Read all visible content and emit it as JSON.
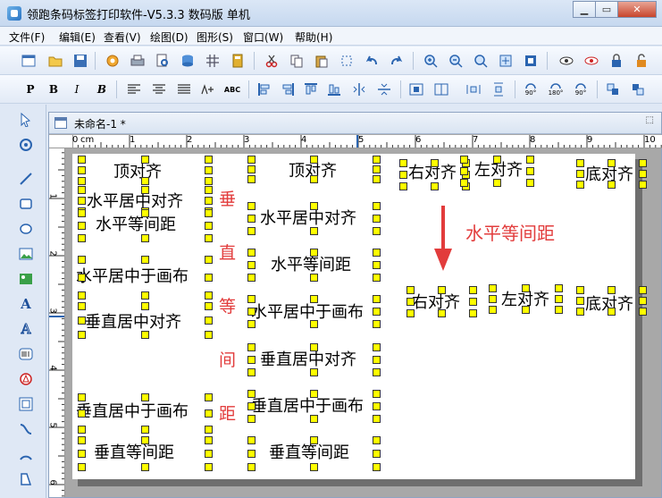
{
  "window": {
    "title": "领跑条码标签打印软件-V5.3.3 数码版 单机"
  },
  "menu": [
    "文件(F)",
    "编辑(E)",
    "查看(V)",
    "绘图(D)",
    "图形(S)",
    "窗口(W)",
    "帮助(H)"
  ],
  "format_toolbar": {
    "bold": "B",
    "italic": "I",
    "abc": "ABC",
    "rot90": "90°",
    "rot180": "180°",
    "rot270": "90°"
  },
  "left_tools": {
    "text_tool": "A",
    "art_text_tool": "A"
  },
  "document": {
    "tab_title": "未命名-1 *",
    "unit": "cm"
  },
  "ruler": {
    "h_marks": [
      "0",
      "1",
      "2",
      "3",
      "4",
      "5",
      "6",
      "7",
      "8",
      "9",
      "10"
    ],
    "v_marks": [
      "1",
      "2",
      "3",
      "4",
      "5",
      "6"
    ]
  },
  "canvas_labels": {
    "col1": [
      "顶对齐",
      "水平居中对齐",
      "水平等间距",
      "水平居中于画布",
      "垂直居中对齐",
      "垂直居中于画布",
      "垂直等间距"
    ],
    "vertical_caption": [
      "垂",
      "直",
      "等",
      "间",
      "距"
    ],
    "col2": [
      "顶对齐",
      "水平居中对齐",
      "水平等间距",
      "水平居中于画布",
      "垂直居中对齐",
      "垂直居中于画布",
      "垂直等间距"
    ],
    "top_row": [
      "右对齐",
      "左对齐",
      "底对齐"
    ],
    "annotation": "水平等间距",
    "bottom_row": [
      "右对齐",
      "左对齐",
      "底对齐"
    ]
  }
}
